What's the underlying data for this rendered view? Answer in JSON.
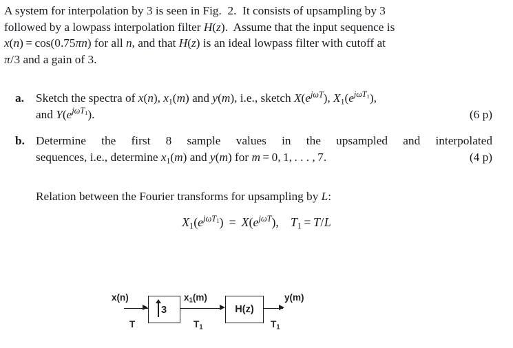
{
  "problem": {
    "paragraph_lines": [
      "A system for interpolation by 3 is seen in Fig. 2. It consists of upsampling by 3",
      "followed by a lowpass interpolation filter H(z). Assume that the input sequence is",
      "x(n) = cos(0.75πn) for all n, and that H(z) is an ideal lowpass filter with cutoff at",
      "π/3 and a gain of 3."
    ]
  },
  "items": [
    {
      "marker": "a.",
      "line1": "Sketch the spectra of x(n), x₁(m) and y(m), i.e., sketch X(e^{jωT}), X₁(e^{jωT₁}),",
      "line2": "and Y(e^{jωT₁}).",
      "points": "(6 p)"
    },
    {
      "marker": "b.",
      "line1": "Determine the first 8 sample values in the upsampled and interpolated",
      "line2": "sequences, i.e., determine x₁(m) and y(m) for m = 0, 1, … , 7.",
      "points": "(4 p)"
    }
  ],
  "relation": {
    "text": "Relation between the Fourier transforms for upsampling by L:"
  },
  "equation": {
    "lhs": "X₁(e^{jωT₁})",
    "equals": "=",
    "rhs": "X(e^{jωT}),",
    "condition": "T₁ = T/L"
  },
  "diagram": {
    "input_label": "x(n)",
    "input_rate": "T",
    "upsampler_factor": "3",
    "upsampler_arrow": "up-arrow",
    "mid_label": "x₁(m)",
    "mid_rate": "T₁",
    "filter_label": "H(z)",
    "output_label": "y(m)",
    "output_rate": "T₁",
    "sub_one": "1"
  },
  "symbols": {
    "x": "x",
    "y": "y",
    "n": "n",
    "m": "m",
    "T": "T",
    "L": "L",
    "H": "H",
    "X": "X",
    "Y": "Y",
    "z": "z",
    "e": "e",
    "j": "j",
    "omega": "ω",
    "pi": "π",
    "three": "3",
    "eight": "8",
    "cos": "cos",
    "freq_value": "0.75",
    "cutoff": "π/3",
    "gain": "3",
    "m_values": "0, 1, . . . , 7",
    "fig_ref": "Fig. 2",
    "one": "1"
  }
}
